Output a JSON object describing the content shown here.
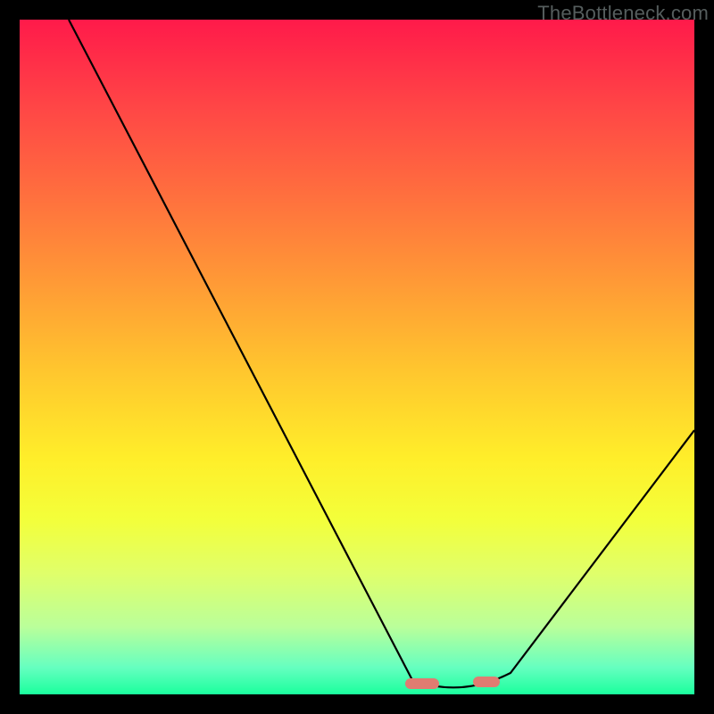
{
  "watermark": "TheBottleneck.com",
  "chart_data": {
    "type": "line",
    "title": "",
    "xlabel": "",
    "ylabel": "",
    "xlim": [
      0,
      100
    ],
    "ylim": [
      0,
      100
    ],
    "grid": false,
    "legend": false,
    "background_gradient": {
      "direction": "vertical",
      "stops": [
        {
          "pos": 0.0,
          "color": "#ff1a4a"
        },
        {
          "pos": 0.13,
          "color": "#ff4646"
        },
        {
          "pos": 0.26,
          "color": "#ff6f3e"
        },
        {
          "pos": 0.39,
          "color": "#ff9a36"
        },
        {
          "pos": 0.52,
          "color": "#ffc62e"
        },
        {
          "pos": 0.65,
          "color": "#ffee2a"
        },
        {
          "pos": 0.74,
          "color": "#f3ff3a"
        },
        {
          "pos": 0.82,
          "color": "#e0ff6a"
        },
        {
          "pos": 0.9,
          "color": "#baff9a"
        },
        {
          "pos": 0.96,
          "color": "#66ffc0"
        },
        {
          "pos": 1.0,
          "color": "#1aff9d"
        }
      ]
    },
    "series": [
      {
        "name": "bottleneck-curve",
        "color": "#000000",
        "x": [
          7,
          15,
          25,
          35,
          45,
          55,
          58,
          62,
          66,
          70,
          73,
          80,
          90,
          100
        ],
        "values": [
          100,
          85,
          66,
          47,
          27,
          8,
          2,
          0,
          0,
          2,
          4,
          14,
          27,
          39
        ]
      }
    ],
    "annotations": [
      {
        "name": "optimal-range-marker",
        "x_range": [
          58,
          73
        ],
        "y": 0,
        "color": "#e07c71"
      }
    ]
  }
}
